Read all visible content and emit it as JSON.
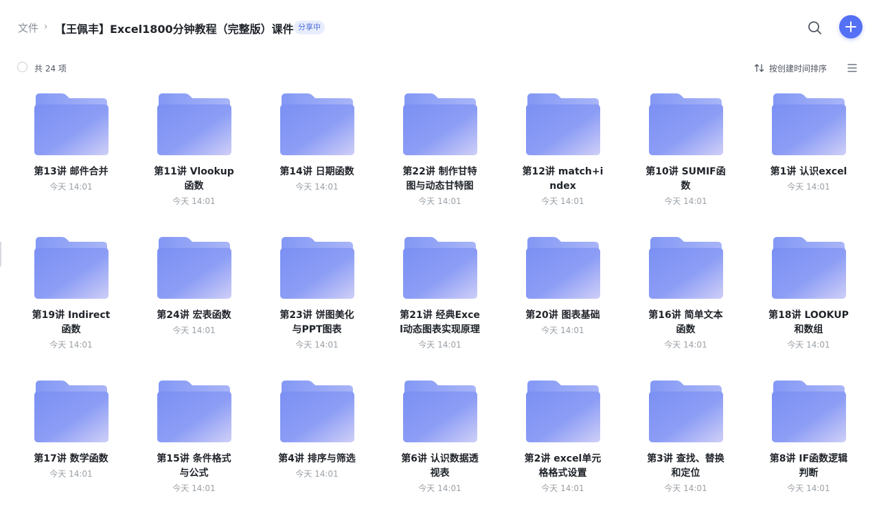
{
  "breadcrumb": {
    "root": "文件",
    "separator": "›",
    "current": "【王佩丰】Excel1800分钟教程（完整版）课件",
    "badge": "分享中"
  },
  "toolbar": {
    "count": "共 24 项",
    "sort_label": "按创建时间排序"
  },
  "icons": {
    "search": "search-icon",
    "add": "plus-icon",
    "sort": "sort-arrows-icon",
    "view": "list-view-icon",
    "folder": "folder-icon"
  },
  "colors": {
    "accent": "#5470f4",
    "folder_top": "#8aa0f6",
    "folder_front": "#7d93f5",
    "folder_front_end": "#c8c9f6"
  },
  "folders": [
    {
      "name": "第13讲 邮件合并",
      "time": "今天 14:01"
    },
    {
      "name": "第11讲 Vlookup函数",
      "time": "今天 14:01"
    },
    {
      "name": "第14讲 日期函数",
      "time": "今天 14:01"
    },
    {
      "name": "第22讲 制作甘特图与动态甘特图",
      "time": "今天 14:01"
    },
    {
      "name": "第12讲 match+index",
      "time": "今天 14:01"
    },
    {
      "name": "第10讲 SUMIF函数",
      "time": "今天 14:01"
    },
    {
      "name": "第1讲 认识excel",
      "time": "今天 14:01"
    },
    {
      "name": "第19讲 Indirect函数",
      "time": "今天 14:01"
    },
    {
      "name": "第24讲 宏表函数",
      "time": "今天 14:01"
    },
    {
      "name": "第23讲 饼图美化与PPT图表",
      "time": "今天 14:01"
    },
    {
      "name": "第21讲 经典Excel动态图表实现原理",
      "time": "今天 14:01"
    },
    {
      "name": "第20讲 图表基础",
      "time": "今天 14:01"
    },
    {
      "name": "第16讲 简单文本函数",
      "time": "今天 14:01"
    },
    {
      "name": "第18讲 LOOKUP和数组",
      "time": "今天 14:01"
    },
    {
      "name": "第17讲 数学函数",
      "time": "今天 14:01"
    },
    {
      "name": "第15讲 条件格式与公式",
      "time": "今天 14:01"
    },
    {
      "name": "第4讲 排序与筛选",
      "time": "今天 14:01"
    },
    {
      "name": "第6讲 认识数据透视表",
      "time": "今天 14:01"
    },
    {
      "name": "第2讲 excel单元格格式设置",
      "time": "今天 14:01"
    },
    {
      "name": "第3讲 查找、替换和定位",
      "time": "今天 14:01"
    },
    {
      "name": "第8讲 IF函数逻辑判断",
      "time": "今天 14:01"
    }
  ]
}
